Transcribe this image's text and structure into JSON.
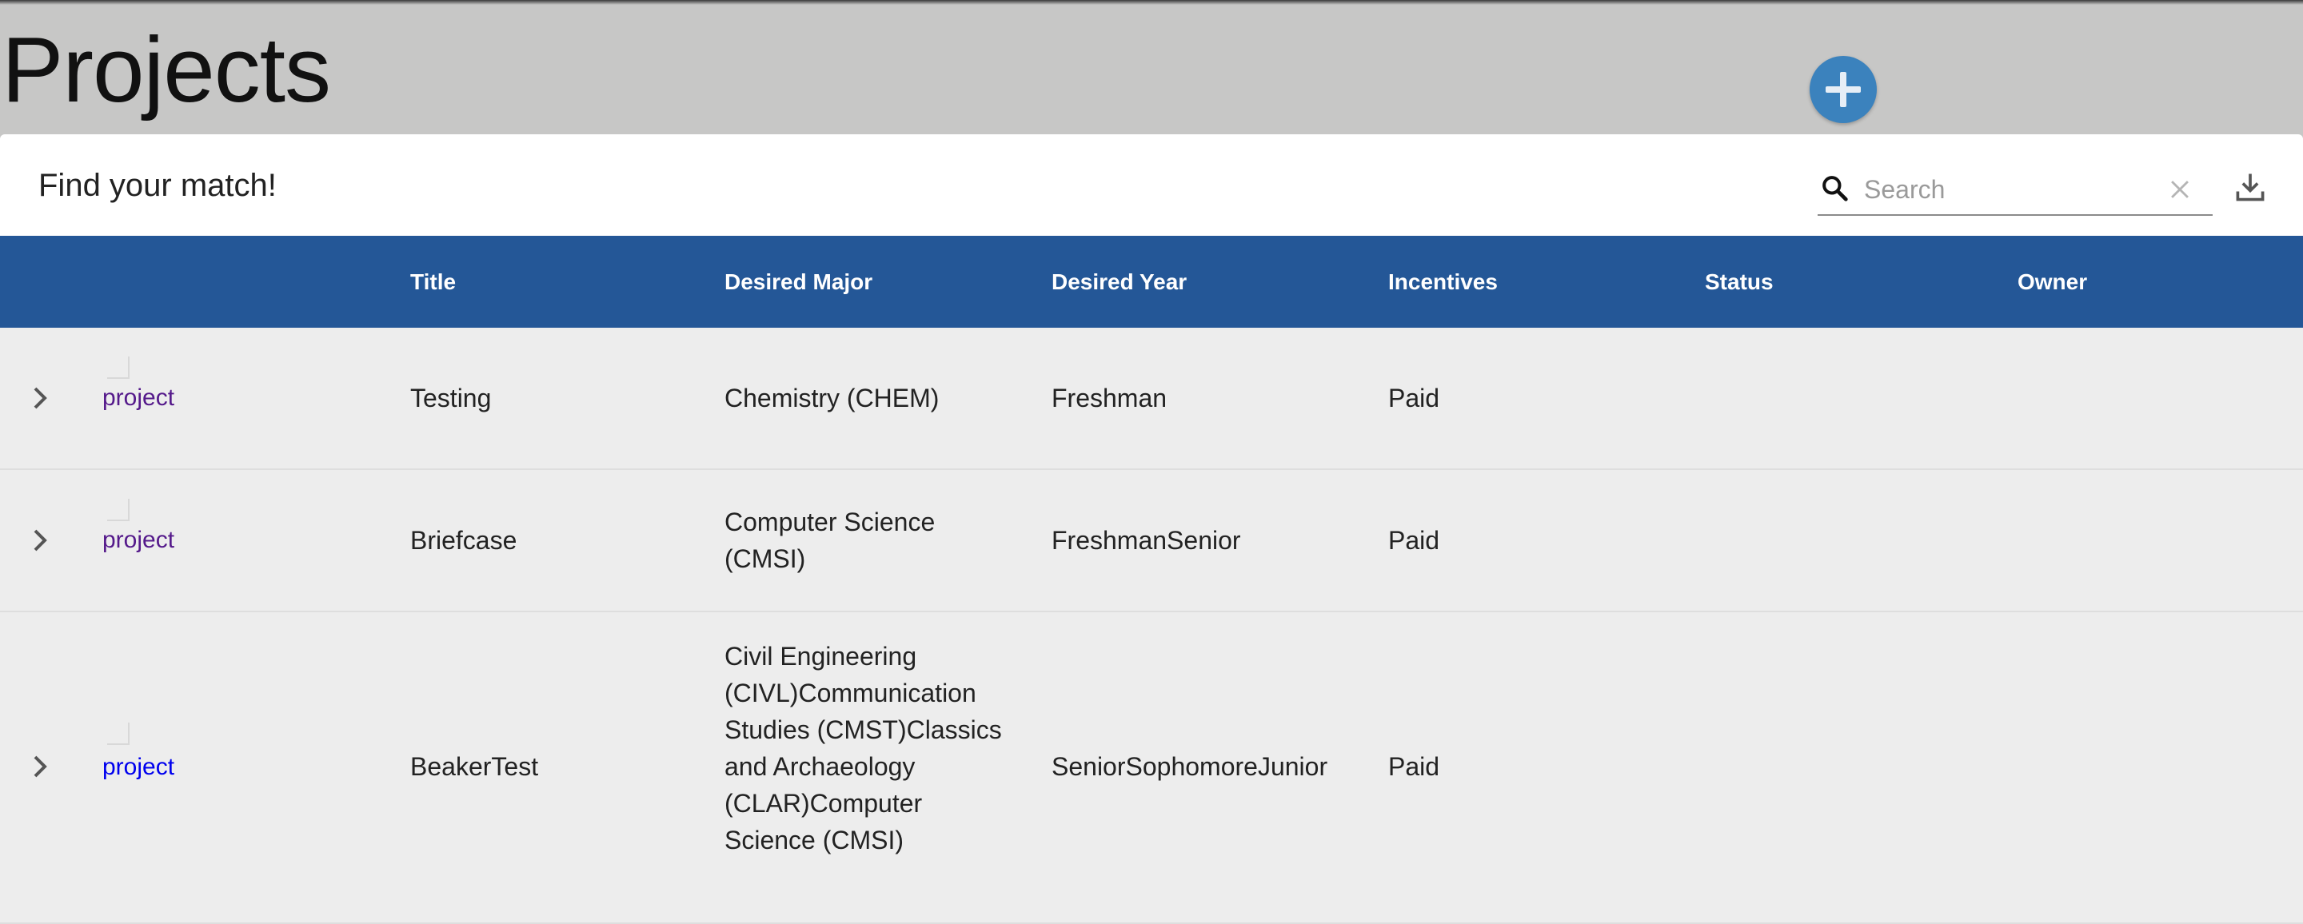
{
  "page": {
    "title": "Projects",
    "add_button_symbol": "+"
  },
  "toolbar": {
    "title": "Find your match!",
    "search_placeholder": "Search",
    "search_value": ""
  },
  "table": {
    "columns": [
      "",
      "Title",
      "Desired Major",
      "Desired Year",
      "Incentives",
      "Status",
      "Owner"
    ],
    "rows": [
      {
        "image_alt": "project",
        "title": "Testing",
        "desired_major": "Chemistry (CHEM)",
        "desired_year": "Freshman",
        "incentives": "Paid",
        "status": "",
        "owner": "",
        "link_color": "#551a8b"
      },
      {
        "image_alt": "project",
        "title": "Briefcase",
        "desired_major": "Computer Science (CMSI)",
        "desired_year": "FreshmanSenior",
        "incentives": "Paid",
        "status": "",
        "owner": "",
        "link_color": "#551a8b"
      },
      {
        "image_alt": "project",
        "title": "BeakerTest",
        "desired_major": "Civil Engineering (CIVL)Communication Studies (CMST)Classics and Archaeology (CLAR)Computer Science (CMSI)",
        "desired_year": "SeniorSophomoreJunior",
        "incentives": "Paid",
        "status": "",
        "owner": "",
        "link_color": "#0000ee"
      }
    ]
  },
  "icons": {
    "add": "plus-icon",
    "search": "search-icon",
    "clear": "close-icon",
    "download": "download-icon",
    "expand": "chevron-right-icon"
  },
  "colors": {
    "background": "#c7c7c6",
    "accent_button": "#3b82bd",
    "header": "#245797",
    "row": "#ededed",
    "visited_link": "#551a8b",
    "link": "#0000ee"
  }
}
